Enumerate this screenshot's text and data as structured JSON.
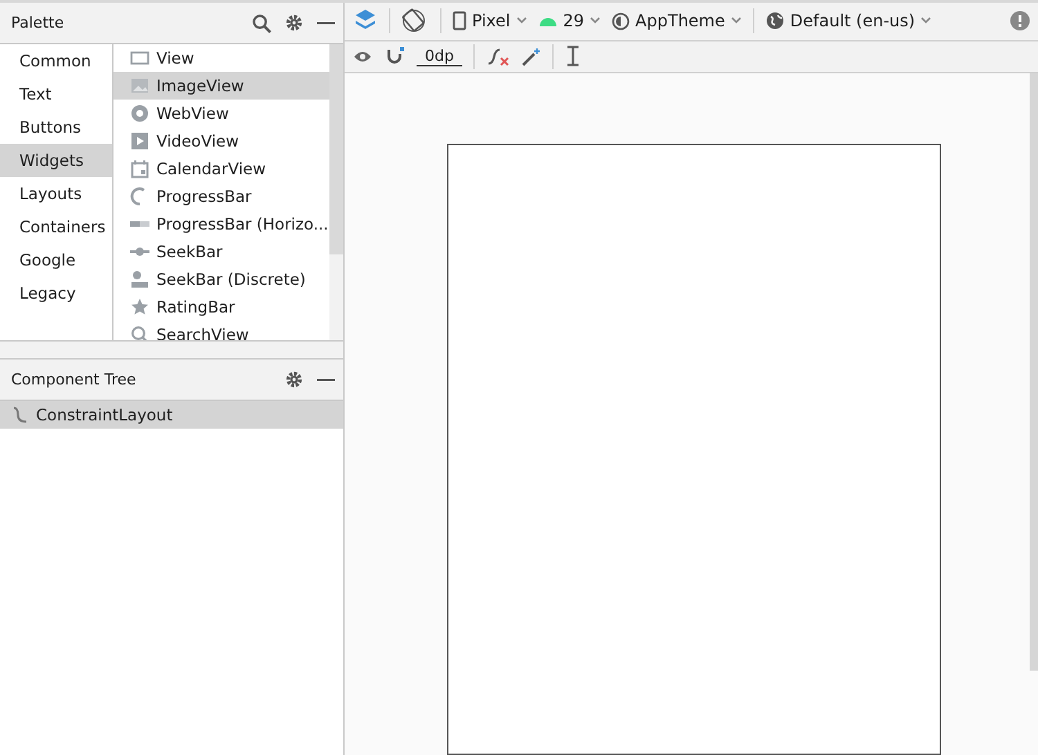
{
  "palette": {
    "title": "Palette",
    "categories": [
      {
        "label": "Common",
        "selected": false
      },
      {
        "label": "Text",
        "selected": false
      },
      {
        "label": "Buttons",
        "selected": false
      },
      {
        "label": "Widgets",
        "selected": true
      },
      {
        "label": "Layouts",
        "selected": false
      },
      {
        "label": "Containers",
        "selected": false
      },
      {
        "label": "Google",
        "selected": false
      },
      {
        "label": "Legacy",
        "selected": false
      }
    ],
    "items": [
      {
        "label": "View",
        "kind": "view",
        "selected": false
      },
      {
        "label": "ImageView",
        "kind": "image",
        "selected": true
      },
      {
        "label": "WebView",
        "kind": "web",
        "selected": false
      },
      {
        "label": "VideoView",
        "kind": "video",
        "selected": false
      },
      {
        "label": "CalendarView",
        "kind": "calendar",
        "selected": false
      },
      {
        "label": "ProgressBar",
        "kind": "progress",
        "selected": false
      },
      {
        "label": "ProgressBar (Horizo...",
        "kind": "hprogress",
        "selected": false
      },
      {
        "label": "SeekBar",
        "kind": "seek",
        "selected": false
      },
      {
        "label": "SeekBar (Discrete)",
        "kind": "discrete",
        "selected": false
      },
      {
        "label": "RatingBar",
        "kind": "star",
        "selected": false
      },
      {
        "label": "SearchView",
        "kind": "search",
        "selected": false
      }
    ]
  },
  "component_tree": {
    "title": "Component Tree",
    "nodes": [
      {
        "label": "ConstraintLayout",
        "selected": true
      }
    ]
  },
  "toolbar": {
    "device": "Pixel",
    "api": "29",
    "theme": "AppTheme",
    "locale": "Default (en-us)",
    "margin": "0dp"
  }
}
